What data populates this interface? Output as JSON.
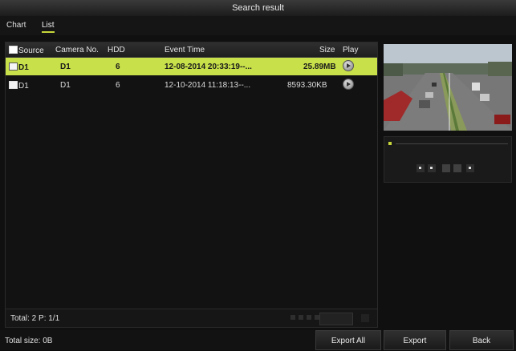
{
  "window": {
    "title": "Search result"
  },
  "tabs": [
    {
      "label": "Chart"
    },
    {
      "label": "List",
      "active": true
    }
  ],
  "table": {
    "headers": {
      "source": "Source",
      "camera": "Camera No.",
      "hdd": "HDD",
      "event_time": "Event Time",
      "size": "Size",
      "play": "Play"
    },
    "rows": [
      {
        "source": "D1",
        "camera": "D1",
        "hdd": "6",
        "event_time": "12-08-2014 20:33:19--...",
        "size": "25.89MB",
        "selected": true
      },
      {
        "source": "D1",
        "camera": "D1",
        "hdd": "6",
        "event_time": "12-10-2014 11:18:13--...",
        "size": "8593.30KB",
        "selected": false
      }
    ]
  },
  "footer": {
    "total": "Total: 2  P: 1/1",
    "total_size": "Total size: 0B"
  },
  "buttons": {
    "export_all": "Export All",
    "export": "Export",
    "back": "Back"
  },
  "colors": {
    "accent": "#c8e04a",
    "background": "#101010"
  },
  "icons": {
    "play": "play-icon",
    "checkbox": "checkbox-icon"
  }
}
